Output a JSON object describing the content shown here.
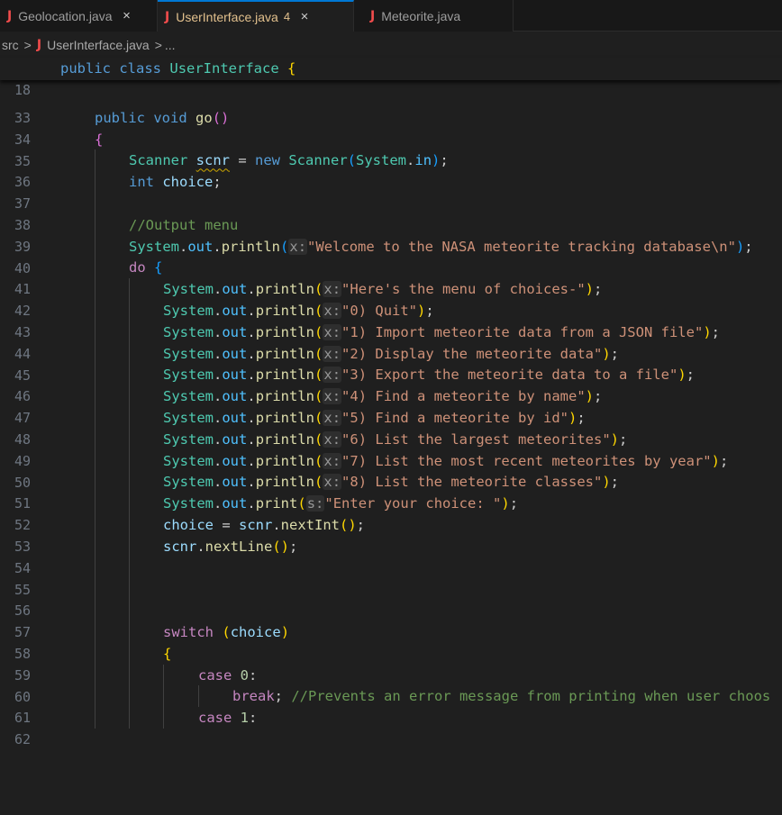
{
  "tabs": [
    {
      "icon": "J",
      "label": "Geolocation.java",
      "close": "×",
      "active": false
    },
    {
      "icon": "J",
      "label": "UserInterface.java",
      "badge": "4",
      "close": "×",
      "active": true
    },
    {
      "icon": "J",
      "label": "Meteorite.java",
      "active": false
    }
  ],
  "breadcrumb": {
    "folder": "src",
    "sep1": ">",
    "icon": "J",
    "file": "UserInterface.java",
    "sep2": ">",
    "more": "..."
  },
  "sticky": {
    "line_number": "18",
    "kw1": "public",
    "kw2": "class",
    "class_name": "UserInterface",
    "brace": "{"
  },
  "lines": {
    "l33": "33",
    "l34": "34",
    "l35": "35",
    "l36": "36",
    "l37": "37",
    "l38": "38",
    "l39": "39",
    "l40": "40",
    "l41": "41",
    "l42": "42",
    "l43": "43",
    "l44": "44",
    "l45": "45",
    "l46": "46",
    "l47": "47",
    "l48": "48",
    "l49": "49",
    "l50": "50",
    "l51": "51",
    "l52": "52",
    "l53": "53",
    "l54": "54",
    "l55": "55",
    "l56": "56",
    "l57": "57",
    "l58": "58",
    "l59": "59",
    "l60": "60",
    "l61": "61",
    "l62": "62"
  },
  "code": {
    "public": "public",
    "void": "void",
    "go": "go",
    "scanner": "Scanner",
    "scnr": "scnr",
    "new": "new",
    "system": "System",
    "in": "in",
    "int": "int",
    "choice": "choice",
    "comment_menu": "//Output menu",
    "out": "out",
    "println": "println",
    "print": "print",
    "hint_x": "x:",
    "hint_s": "s:",
    "do": "do",
    "s40": "\"Welcome to the NASA meteorite tracking database\\n\"",
    "s42": "\"Here's the menu of choices-\"",
    "s43": "\"0) Quit\"",
    "s44": "\"1) Import meteorite data from a JSON file\"",
    "s45": "\"2) Display the meteorite data\"",
    "s46": "\"3) Export the meteorite data to a file\"",
    "s47": "\"4) Find a meteorite by name\"",
    "s48": "\"5) Find a meteorite by id\"",
    "s49": "\"6) List the largest meteorites\"",
    "s50": "\"7) List the most recent meteorites by year\"",
    "s51": "\"8) List the meteorite classes\"",
    "s52": "\"Enter your choice: \"",
    "nextInt": "nextInt",
    "nextLine": "nextLine",
    "switch": "switch",
    "case": "case",
    "zero": "0",
    "one": "1",
    "break": "break",
    "comment61": "//Prevents an error message from printing when user choos"
  },
  "colors": {
    "editor_bg": "#1f1f1f",
    "tab_active_border": "#0078d4",
    "modified": "#e2c08d",
    "java_icon": "#f14c4c"
  }
}
